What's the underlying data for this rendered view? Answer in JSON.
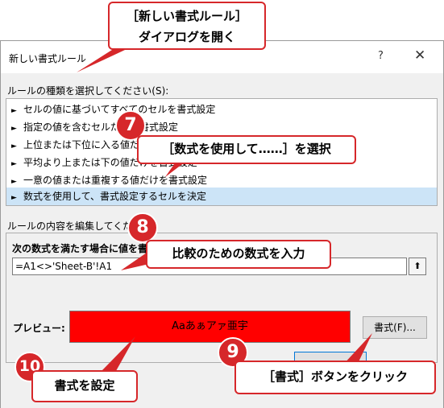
{
  "dialog": {
    "title": "新しい書式ルール",
    "help_glyph": "?",
    "close_glyph": "✕"
  },
  "rule_type": {
    "label": "ルールの種類を選択してください(S):",
    "items": [
      "セルの値に基づいてすべてのセルを書式設定",
      "指定の値を含むセルだけを書式設定",
      "上位または下位に入る値だけを書式設定",
      "平均より上または下の値だけを書式設定",
      "一意の値または重複する値だけを書式設定",
      "数式を使用して、書式設定するセルを決定"
    ],
    "selected_index": 5
  },
  "rule_edit": {
    "label": "ルールの内容を編集してください",
    "formula_label": "次の数式を満たす場合に値を書",
    "formula_value": "=A1<>'Sheet-B'!A1",
    "collapse_glyph": "⬆",
    "preview_label": "プレビュー:",
    "preview_text": "Aaあぁアァ亜宇",
    "preview_color": "#ff0000",
    "format_button": "書式(F)..."
  },
  "annotations": {
    "accent_color": "#d6272a",
    "top_callout_line1": "［新しい書式ルール］",
    "top_callout_line2": "ダイアログを開く",
    "step7_number": "7",
    "step7_text": "［数式を使用して……］を選択",
    "step8_number": "8",
    "step8_text": "比較のための数式を入力",
    "step9_number": "9",
    "step9_text": "［書式］ボタンをクリック",
    "step10_number": "10",
    "step10_text": "書式を設定"
  }
}
